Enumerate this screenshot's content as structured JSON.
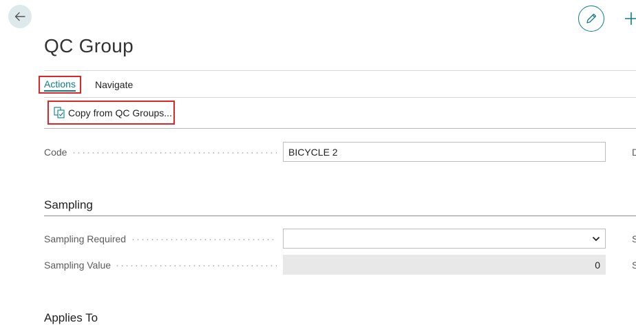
{
  "page": {
    "title": "QC Group"
  },
  "header": {
    "back_icon": "arrow-left-icon",
    "edit_icon": "pencil-icon",
    "new_icon": "plus-icon"
  },
  "actionbar": {
    "tabs": [
      "Actions",
      "Navigate"
    ],
    "actions": [
      {
        "label": "Copy from QC Groups...",
        "icon": "copy-document-icon"
      }
    ]
  },
  "general": {
    "code_label": "Code",
    "code_value": "BICYCLE 2",
    "right_edge_label_fragment": "D"
  },
  "sampling": {
    "section_title": "Sampling",
    "sampling_required_label": "Sampling Required",
    "sampling_required_value": "",
    "sampling_value_label": "Sampling Value",
    "sampling_value_value": "0",
    "right_edge_fragment_1": "S",
    "right_edge_fragment_2": "S"
  },
  "applies_to": {
    "section_title": "Applies To"
  },
  "colors": {
    "accent": "#0b7f86",
    "highlight_border": "#d9262a",
    "back_button_bg": "#dde9ea"
  }
}
